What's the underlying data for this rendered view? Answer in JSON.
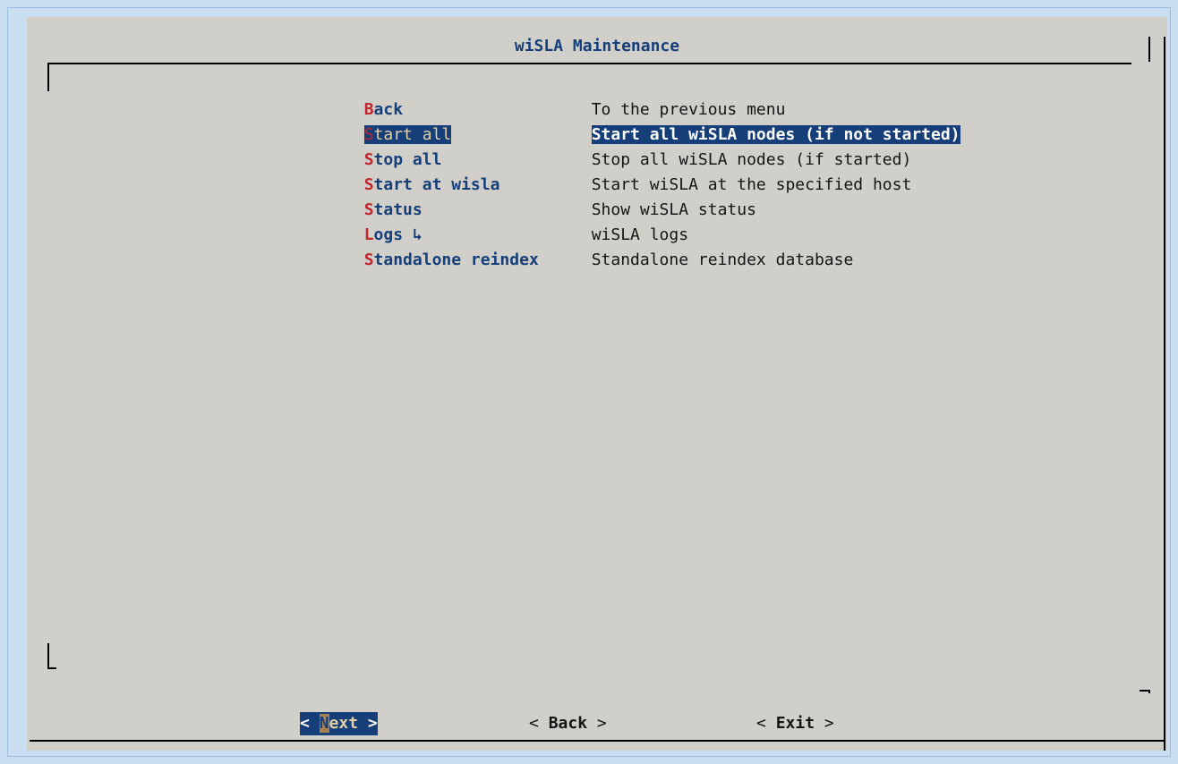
{
  "dialog": {
    "title": "wiSLA Maintenance"
  },
  "menu": {
    "items": [
      {
        "hot": "B",
        "rest": "ack",
        "desc": "To the previous menu"
      },
      {
        "hot": "S",
        "rest": "tart all",
        "desc": "Start all wiSLA nodes (if not started)",
        "selected": true
      },
      {
        "hot": "S",
        "rest": "top all",
        "desc": "Stop all wiSLA nodes (if started)"
      },
      {
        "hot": "S",
        "rest": "tart at wisla",
        "desc": "Start wiSLA at the specified host"
      },
      {
        "hot": "S",
        "rest": "tatus",
        "desc": "Show wiSLA status"
      },
      {
        "hot": "L",
        "rest": "ogs ↳",
        "desc": "wiSLA logs"
      },
      {
        "hot": "S",
        "rest": "tandalone reindex",
        "desc": "Standalone reindex database"
      }
    ]
  },
  "buttons": {
    "next": {
      "left": "< ",
      "hot": "N",
      "rest": "ext",
      "right": " >"
    },
    "back": {
      "left": "< ",
      "label": "Back",
      "right": " >"
    },
    "exit": {
      "left": "< ",
      "label": "Exit",
      "right": " >"
    }
  },
  "colors": {
    "background": "#c9def0",
    "dialog": "#d1cfca",
    "accent": "#163f7a",
    "hotkey": "#c0262c"
  }
}
